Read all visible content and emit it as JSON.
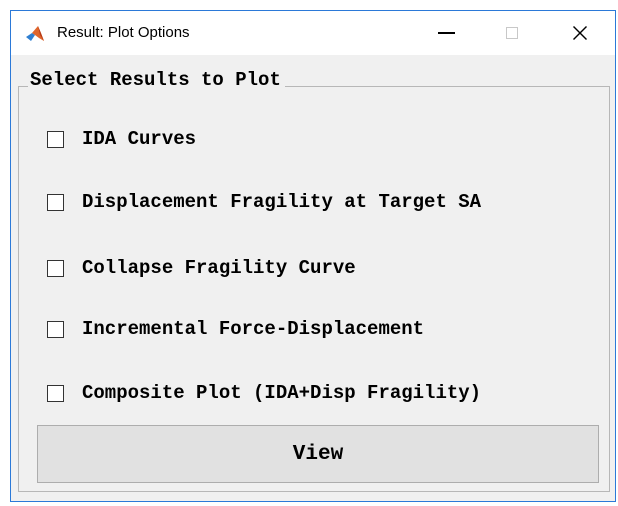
{
  "window": {
    "title": "Result: Plot Options",
    "icon": "matlab-icon",
    "controls": [
      "minimize-icon",
      "maximize-icon",
      "close-icon"
    ]
  },
  "panel": {
    "title": "Select Results to Plot",
    "options": [
      {
        "label": "IDA Curves",
        "checked": false
      },
      {
        "label": "Displacement Fragility at Target SA",
        "checked": false
      },
      {
        "label": "Collapse Fragility Curve",
        "checked": false
      },
      {
        "label": "Incremental Force-Displacement",
        "checked": false
      },
      {
        "label": "Composite Plot (IDA+Disp Fragility)",
        "checked": false
      }
    ]
  },
  "view_button": {
    "label": "View"
  },
  "colors": {
    "window_border": "#2b79d8",
    "background": "#f0f0f0",
    "button": "#e1e1e1"
  }
}
